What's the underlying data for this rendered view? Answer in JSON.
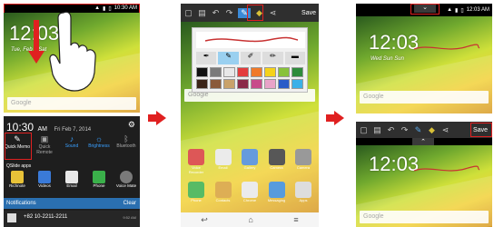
{
  "panel1": {
    "status_time": "10:30 AM",
    "clock": "12:03",
    "weather": "Tue, Feb 7 Sat",
    "google": "Google",
    "shade": {
      "time": "10:30",
      "ampm": "AM",
      "date": "Fri Feb 7, 2014",
      "toggles": [
        {
          "label": "Quick Memo",
          "icon": "quick-memo-icon"
        },
        {
          "label": "Quick Remote",
          "icon": "remote-icon"
        },
        {
          "label": "Sound",
          "icon": "sound-icon"
        },
        {
          "label": "Brightness",
          "icon": "brightness-icon"
        },
        {
          "label": "Bluetooth",
          "icon": "bluetooth-icon"
        }
      ],
      "qslide_title": "QSlide apps",
      "qslide": [
        "Richnote",
        "Videos",
        "Email",
        "Phone",
        "Voice Mate"
      ],
      "notifications": "Notifications",
      "clear": "Clear",
      "notif_number": "+82 10-2211-2211",
      "notif_time": "9:52 AM"
    }
  },
  "panel2": {
    "save": "Save",
    "google": "Google",
    "apps_row1": [
      "Voice Recorder",
      "Email",
      "Gallery",
      "Camera",
      "Camera"
    ],
    "apps_row2": [
      "Phone",
      "Contacts",
      "Chrome",
      "Messaging",
      "Apps"
    ]
  },
  "panel3": {
    "status_time": "12:03 AM",
    "clock": "12:03",
    "weather": "Wed Sun Sun",
    "google": "Google",
    "clock2": "12:03",
    "save": "Save",
    "google2": "Google"
  },
  "colors": {
    "accent_red": "#e02020",
    "palette_row1": [
      "#111111",
      "#7a7a7a",
      "#e8e8e8",
      "#e33d3d",
      "#f07a2a",
      "#f5d21a",
      "#88c23a",
      "#2e8c3b"
    ],
    "palette_row2": [
      "#3b2418",
      "#8a5a3a",
      "#c9a26a",
      "#8a2a48",
      "#c84a8a",
      "#e8a3c8",
      "#2a5cc8",
      "#3ab0e8"
    ]
  }
}
